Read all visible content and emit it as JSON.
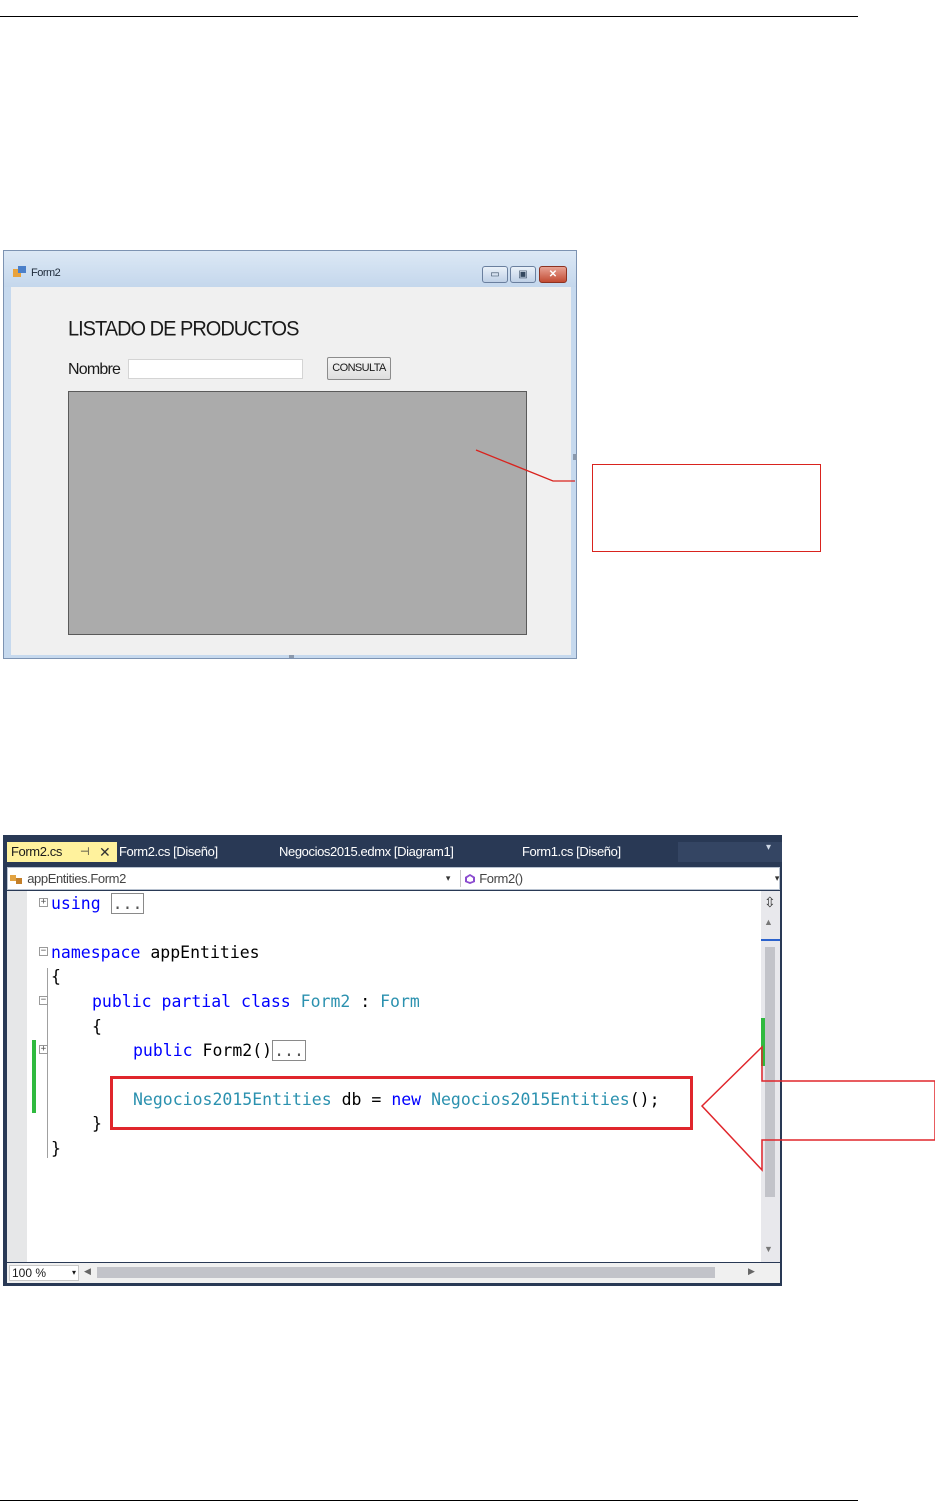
{
  "form_window": {
    "title": "Form2",
    "heading": "LISTADO DE PRODUCTOS",
    "nombre_label": "Nombre",
    "nombre_value": "",
    "consulta_button": "CONSULTA",
    "minimize_glyph": "▭",
    "maximize_glyph": "▣",
    "close_glyph": "✕"
  },
  "editor": {
    "tabs": [
      {
        "label": "Form2.cs",
        "pin": "⊣",
        "close": "✕"
      },
      {
        "label": "Form2.cs [Diseño]"
      },
      {
        "label": "Negocios2015.edmx [Diagram1]"
      },
      {
        "label": "Form1.cs [Diseño]"
      }
    ],
    "tab_dropdown": "▾",
    "nav_left": "appEntities.Form2",
    "nav_right": "Form2()",
    "code": {
      "using_kw": "using",
      "collapsed_using": "...",
      "namespace_kw": "namespace",
      "namespace_name": "appEntities",
      "open_brace": "{",
      "close_brace": "}",
      "public_kw": "public",
      "partial_kw": "partial",
      "class_kw": "class",
      "class_name": "Form2",
      "colon": ":",
      "base_class": "Form",
      "ctor": "Form2()",
      "collapsed_ctor": "...",
      "field_type": "Negocios2015Entities",
      "field_decl": "db =",
      "new_kw": "new",
      "field_init": "Negocios2015Entities",
      "call_end": "();"
    },
    "zoom": "100 %"
  },
  "colors": {
    "keyword": "#0000ff",
    "type": "#2b91af",
    "annotation_red": "#e0262c",
    "change_green": "#2fba3f"
  },
  "icons": [
    "app-icon",
    "class-icon",
    "method-icon",
    "plus-fold-icon",
    "minus-fold-icon",
    "scroll-arrow-icon"
  ]
}
